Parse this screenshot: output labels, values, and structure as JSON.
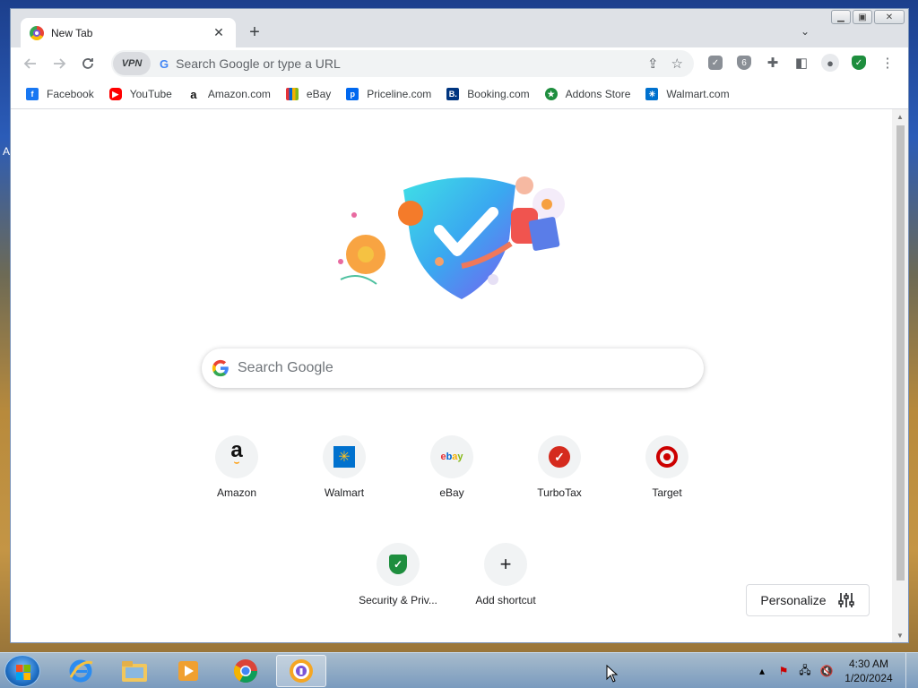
{
  "browser": {
    "tab": {
      "title": "New Tab"
    },
    "omnibox": {
      "vpn_label": "VPN",
      "placeholder": "Search Google or type a URL"
    },
    "bookmarks": [
      {
        "label": "Facebook",
        "icon": "facebook-icon",
        "color": "#1877f2"
      },
      {
        "label": "YouTube",
        "icon": "youtube-icon",
        "color": "#ff0000"
      },
      {
        "label": "Amazon.com",
        "icon": "amazon-icon",
        "color": "#232f3e"
      },
      {
        "label": "eBay",
        "icon": "ebay-icon",
        "color": "#e53238"
      },
      {
        "label": "Priceline.com",
        "icon": "priceline-icon",
        "color": "#0068ef"
      },
      {
        "label": "Booking.com",
        "icon": "booking-icon",
        "color": "#003580"
      },
      {
        "label": "Addons Store",
        "icon": "addons-store-icon",
        "color": "#1e8e3e"
      },
      {
        "label": "Walmart.com",
        "icon": "walmart-icon",
        "color": "#0071ce"
      }
    ]
  },
  "ntp": {
    "search_placeholder": "Search Google",
    "shortcuts": [
      {
        "label": "Amazon",
        "icon": "amazon-icon"
      },
      {
        "label": "Walmart",
        "icon": "walmart-icon"
      },
      {
        "label": "eBay",
        "icon": "ebay-icon"
      },
      {
        "label": "TurboTax",
        "icon": "turbotax-icon"
      },
      {
        "label": "Target",
        "icon": "target-icon"
      },
      {
        "label": "Security & Priv...",
        "icon": "security-shield-icon"
      },
      {
        "label": "Add shortcut",
        "icon": "plus-icon"
      }
    ],
    "personalize_label": "Personalize"
  },
  "taskbar": {
    "clock_time": "4:30 AM",
    "clock_date": "1/20/2024"
  },
  "colors": {
    "accent_blue": "#4285f4",
    "shield_green": "#1e8e3e",
    "turbotax_red": "#d52b1e",
    "target_red": "#cc0000"
  }
}
